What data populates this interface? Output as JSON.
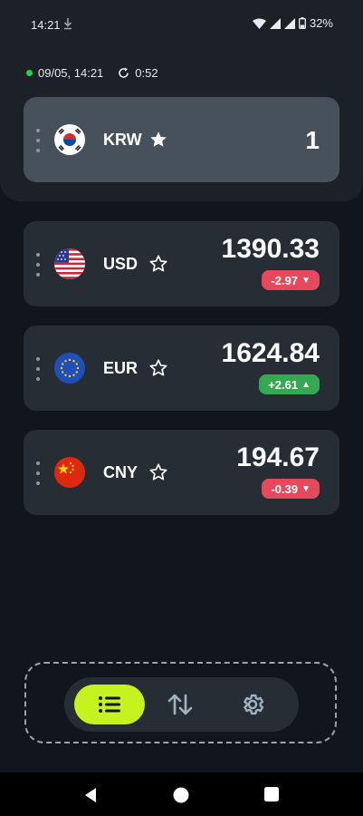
{
  "status_bar": {
    "time": "14:21",
    "battery": "32%"
  },
  "update": {
    "datetime": "09/05, 14:21",
    "timer": "0:52"
  },
  "base_currency": {
    "code": "KRW",
    "value": "1",
    "favorite": true,
    "flag": "south-korea-flag-icon"
  },
  "rates": [
    {
      "code": "USD",
      "value": "1390.33",
      "change": "-2.97",
      "direction": "down",
      "favorite": false,
      "flag": "usa-flag-icon"
    },
    {
      "code": "EUR",
      "value": "1624.84",
      "change": "+2.61",
      "direction": "up",
      "favorite": false,
      "flag": "eu-flag-icon"
    },
    {
      "code": "CNY",
      "value": "194.67",
      "change": "-0.39",
      "direction": "down",
      "favorite": false,
      "flag": "china-flag-icon"
    }
  ],
  "nav": {
    "items": [
      "list-icon",
      "swap-icon",
      "gear-icon"
    ],
    "active": "list-icon"
  },
  "colors": {
    "accent": "#c5f31f",
    "down": "#e5495b",
    "up": "#34a853",
    "live": "#2ecc40"
  }
}
